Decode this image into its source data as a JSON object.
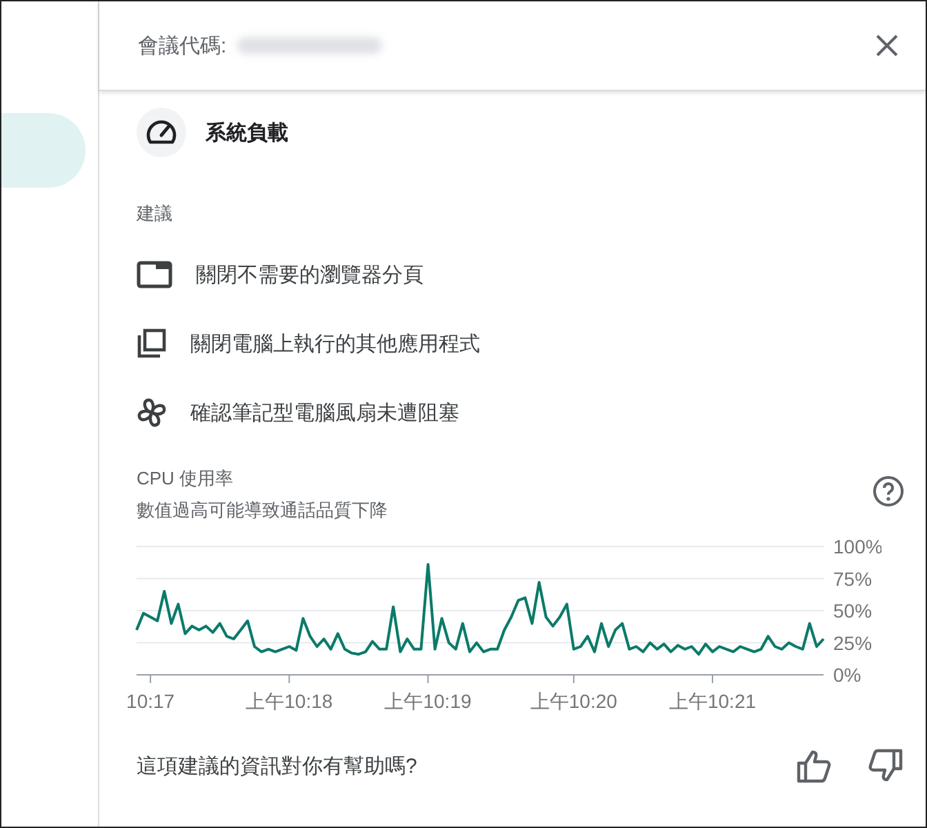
{
  "header": {
    "label": "會議代碼:"
  },
  "section": {
    "title": "系統負載"
  },
  "suggestions": {
    "heading": "建議",
    "items": [
      {
        "kind": "tab",
        "text": "關閉不需要的瀏覽器分頁"
      },
      {
        "kind": "windows",
        "text": "關閉電腦上執行的其他應用程式"
      },
      {
        "kind": "fan",
        "text": "確認筆記型電腦風扇未遭阻塞"
      }
    ]
  },
  "cpu": {
    "title": "CPU 使用率",
    "subtitle": "數值過高可能導致通話品質下降",
    "chart_data": {
      "type": "line",
      "ylim": [
        0,
        100
      ],
      "categories": [
        null,
        null,
        "10:17",
        null,
        null,
        null,
        null,
        null,
        null,
        null,
        null,
        null,
        null,
        null,
        null,
        null,
        null,
        null,
        null,
        null,
        null,
        null,
        "上午10:18",
        null,
        null,
        null,
        null,
        null,
        null,
        null,
        null,
        null,
        null,
        null,
        null,
        null,
        null,
        null,
        null,
        null,
        null,
        null,
        "上午10:19",
        null,
        null,
        null,
        null,
        null,
        null,
        null,
        null,
        null,
        null,
        null,
        null,
        null,
        null,
        null,
        null,
        null,
        null,
        null,
        null,
        "上午10:20",
        null,
        null,
        null,
        null,
        null,
        null,
        null,
        null,
        null,
        null,
        null,
        null,
        null,
        null,
        null,
        null,
        null,
        null,
        null,
        "上午10:21",
        null,
        null,
        null,
        null,
        null,
        null,
        null,
        null,
        null,
        null,
        null,
        null,
        null,
        null,
        null,
        null
      ],
      "yticks": [
        {
          "value": 0,
          "label": "0%"
        },
        {
          "value": 25,
          "label": "25%"
        },
        {
          "value": 50,
          "label": "50%"
        },
        {
          "value": 75,
          "label": "75%"
        },
        {
          "value": 100,
          "label": "100%"
        }
      ],
      "grid": true,
      "series": [
        {
          "color": "#0b7a69",
          "values": [
            35,
            48,
            45,
            42,
            65,
            40,
            55,
            32,
            38,
            35,
            38,
            33,
            40,
            30,
            28,
            35,
            42,
            22,
            18,
            20,
            18,
            20,
            22,
            19,
            44,
            30,
            22,
            28,
            20,
            32,
            20,
            17,
            16,
            18,
            26,
            20,
            20,
            53,
            18,
            28,
            20,
            20,
            86,
            20,
            44,
            25,
            20,
            40,
            18,
            25,
            18,
            20,
            20,
            35,
            45,
            58,
            60,
            40,
            72,
            45,
            38,
            45,
            55,
            20,
            22,
            30,
            18,
            40,
            22,
            35,
            40,
            20,
            22,
            18,
            25,
            20,
            24,
            18,
            23,
            20,
            22,
            16,
            24,
            18,
            22,
            20,
            18,
            22,
            20,
            18,
            20,
            30,
            22,
            20,
            25,
            22,
            20,
            40,
            22,
            28
          ]
        }
      ]
    }
  },
  "feedback": {
    "question": "這項建議的資訊對你有幫助嗎?"
  }
}
